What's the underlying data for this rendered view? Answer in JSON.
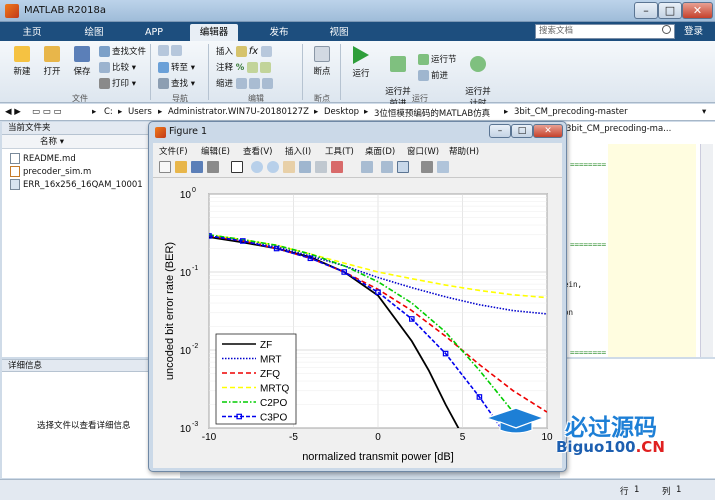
{
  "window": {
    "title": "MATLAB R2018a"
  },
  "tabs": [
    "主页",
    "绘图",
    "APP",
    "编辑器",
    "发布",
    "视图"
  ],
  "active_tab": "编辑器",
  "search": {
    "placeholder": "搜索文档"
  },
  "login": "登录",
  "toolstrip": {
    "file": {
      "new": "新建",
      "open": "打开",
      "save": "保存",
      "find_files": "查找文件",
      "compare": "比较",
      "print": "打印",
      "group": "文件"
    },
    "nav": {
      "goto": "转至",
      "find": "查找",
      "group": "导航"
    },
    "edit": {
      "insert": "插入",
      "comment": "注释",
      "indent": "缩进",
      "group": "编辑"
    },
    "breakpoints": {
      "label": "断点",
      "group": "断点"
    },
    "run": {
      "run": "运行",
      "run_advance": "运行并\n前进",
      "run_section": "运行节",
      "advance": "前进",
      "run_time": "运行并\n计时",
      "group": "运行"
    }
  },
  "address": [
    "C:",
    "Users",
    "Administrator.WIN7U-20180127Z",
    "Desktop",
    "3位恒模预编码的MATLAB仿真",
    "3bit_CM_precoding-master"
  ],
  "current_folder": {
    "title": "当前文件夹",
    "column": "名称",
    "files": [
      "README.md",
      "precoder_sim.m",
      "ERR_16x256_16QAM_10001"
    ]
  },
  "details": {
    "title": "详细信息",
    "text": "选择文件以查看详细信息"
  },
  "editor": {
    "head": "3bit_CM_precoding-ma...",
    "code": [
      "ein,",
      "on"
    ]
  },
  "status": {
    "row_label": "行",
    "row": "1",
    "col_label": "列",
    "col": "1"
  },
  "figure": {
    "title": "Figure 1",
    "menus": [
      "文件(F)",
      "编辑(E)",
      "查看(V)",
      "插入(I)",
      "工具(T)",
      "桌面(D)",
      "窗口(W)",
      "帮助(H)"
    ]
  },
  "chart_data": {
    "type": "line",
    "xlabel": "normalized transmit power [dB]",
    "ylabel": "uncoded bit error rate (BER)",
    "xlim": [
      -10,
      10
    ],
    "ylim": [
      0.001,
      1
    ],
    "yscale": "log",
    "xticks": [
      -10,
      -5,
      0,
      5,
      10
    ],
    "yticks": [
      0.001,
      0.01,
      0.1,
      1
    ],
    "ytick_labels": [
      [
        "10",
        "-3"
      ],
      [
        "10",
        "-2"
      ],
      [
        "10",
        "-1"
      ],
      [
        "10",
        "0"
      ]
    ],
    "grid": true,
    "legend_position": "bottom-left",
    "series": [
      {
        "name": "ZF",
        "color": "#000000",
        "dash": "",
        "marker": "",
        "x": [
          -10,
          -8,
          -6,
          -4,
          -2,
          0,
          2,
          3,
          4,
          5
        ],
        "y": [
          0.28,
          0.24,
          0.2,
          0.155,
          0.1,
          0.05,
          0.013,
          0.0055,
          0.002,
          0.0008
        ]
      },
      {
        "name": "MRT",
        "color": "#0000cc",
        "dash": "1.5,1.5",
        "marker": "",
        "x": [
          -10,
          -8,
          -6,
          -4,
          -2,
          0,
          2,
          4,
          6,
          8,
          10
        ],
        "y": [
          0.29,
          0.25,
          0.21,
          0.16,
          0.12,
          0.085,
          0.063,
          0.048,
          0.038,
          0.032,
          0.029
        ]
      },
      {
        "name": "ZFQ",
        "color": "#ee0000",
        "dash": "5,3",
        "marker": "",
        "x": [
          -10,
          -8,
          -6,
          -4,
          -2,
          0,
          2,
          4,
          6,
          8,
          10
        ],
        "y": [
          0.29,
          0.25,
          0.2,
          0.15,
          0.1,
          0.06,
          0.032,
          0.015,
          0.0065,
          0.003,
          0.0016
        ]
      },
      {
        "name": "MRTQ",
        "color": "#ffff00",
        "dash": "5,3",
        "marker": "",
        "x": [
          -10,
          -8,
          -6,
          -4,
          -2,
          0,
          2,
          4,
          6,
          8,
          10
        ],
        "y": [
          0.3,
          0.26,
          0.22,
          0.17,
          0.13,
          0.1,
          0.082,
          0.068,
          0.058,
          0.051,
          0.047
        ]
      },
      {
        "name": "C2PO",
        "color": "#00cc00",
        "dash": "5,2,1.5,2",
        "marker": "",
        "x": [
          -10,
          -8,
          -6,
          -4,
          -2,
          0,
          2,
          4,
          6,
          8,
          10
        ],
        "y": [
          0.3,
          0.26,
          0.22,
          0.17,
          0.12,
          0.075,
          0.04,
          0.017,
          0.0055,
          0.0016,
          0.0004
        ]
      },
      {
        "name": "C3PO",
        "color": "#0000ee",
        "dash": "4,2",
        "marker": "square",
        "x": [
          -10,
          -8,
          -6,
          -4,
          -2,
          0,
          2,
          4,
          6,
          8
        ],
        "y": [
          0.29,
          0.25,
          0.2,
          0.15,
          0.1,
          0.055,
          0.025,
          0.009,
          0.0025,
          0.0006
        ]
      }
    ]
  },
  "watermark": {
    "line1": "必过源码",
    "line2_a": "Biguo100",
    "line2_b": ".CN"
  }
}
